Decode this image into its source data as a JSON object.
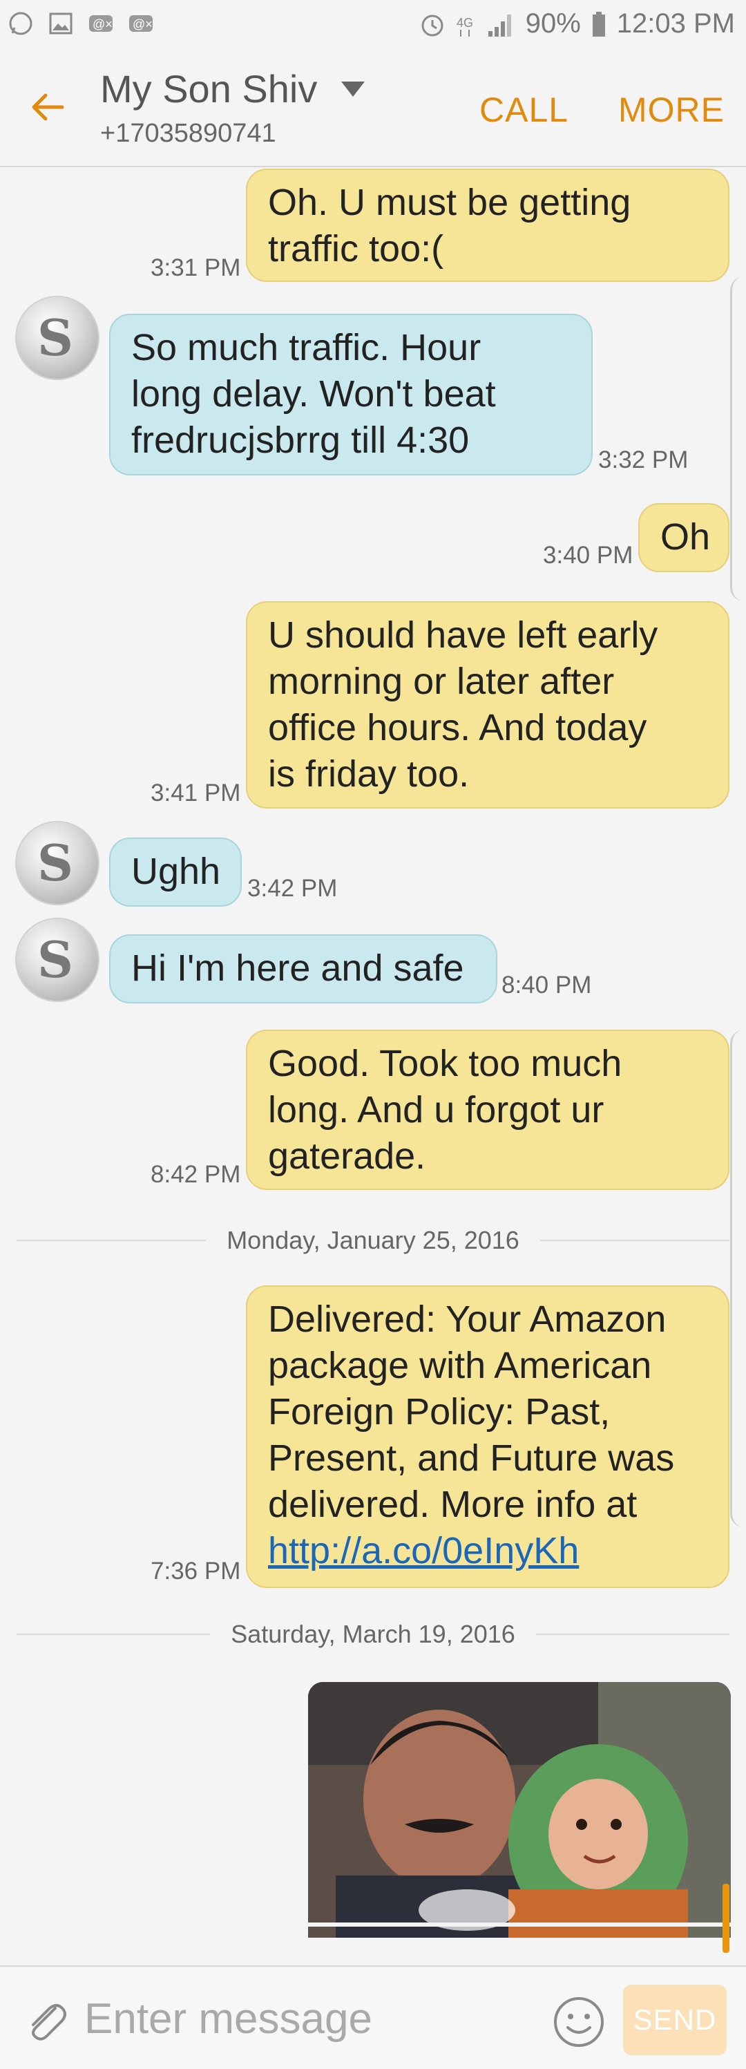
{
  "status_bar": {
    "battery": "90%",
    "time": "12:03 PM"
  },
  "header": {
    "contact_name": "My Son Shiv",
    "phone_number": "+17035890741",
    "call_label": "CALL",
    "more_label": "MORE"
  },
  "messages": [
    {
      "direction": "out",
      "text_lines": [
        "Oh. U must be getting",
        "traffic too:("
      ],
      "time": "3:31 PM"
    },
    {
      "direction": "in",
      "text_lines": [
        "So much traffic.  Hour",
        "long delay. Won't beat",
        "fredrucjsbrrg till 4:30"
      ],
      "time": "3:32 PM"
    },
    {
      "direction": "out",
      "text_lines": [
        "Oh"
      ],
      "time": "3:40 PM"
    },
    {
      "direction": "out",
      "text_lines": [
        "U should have left early",
        "morning or later after",
        "office hours. And today",
        "is friday too."
      ],
      "time": "3:41 PM"
    },
    {
      "direction": "in",
      "text_lines": [
        "Ughh"
      ],
      "time": "3:42 PM"
    },
    {
      "direction": "in",
      "text_lines": [
        "Hi I'm here and safe"
      ],
      "time": "8:40 PM"
    },
    {
      "direction": "out",
      "text_lines": [
        "Good. Took too much",
        "long. And u forgot ur",
        "gaterade."
      ],
      "time": "8:42 PM"
    },
    {
      "direction": "out",
      "text_lines": [
        "Delivered: Your Amazon",
        "package with American",
        "Foreign Policy: Past,",
        "Present, and Future was",
        "delivered. More info at"
      ],
      "link": "http://a.co/0eInyKh",
      "time": "7:36 PM"
    }
  ],
  "date_separators": [
    "Monday, January 25, 2016",
    "Saturday, March 19, 2016"
  ],
  "input": {
    "placeholder": "Enter message",
    "send_label": "SEND"
  },
  "colors": {
    "accent": "#e08a0e",
    "outgoing_bubble": "#f6e597",
    "incoming_bubble": "#c9e9ee",
    "link": "#1a66b8"
  },
  "icons": {
    "status_left": [
      "whatsapp-icon",
      "gallery-icon",
      "missed-call-icon",
      "missed-call-icon"
    ],
    "status_right": [
      "alarm-icon",
      "data-4g-icon",
      "signal-icon",
      "battery-icon"
    ],
    "header": [
      "back-arrow-icon",
      "chevron-down-icon"
    ],
    "input_bar": [
      "attach-icon",
      "emoji-icon"
    ]
  }
}
